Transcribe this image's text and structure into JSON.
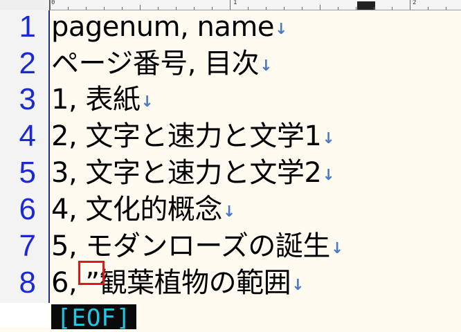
{
  "ruler": {
    "labels": [
      "0",
      "1",
      "2"
    ]
  },
  "lines": [
    {
      "number": "1",
      "text": "pagenum, name"
    },
    {
      "number": "2",
      "text": "ページ番号, 目次"
    },
    {
      "number": "3",
      "text": "1, 表紙"
    },
    {
      "number": "4",
      "text": "2, 文字と速力と文学1"
    },
    {
      "number": "5",
      "text": "3, 文字と速力と文学2"
    },
    {
      "number": "6",
      "text": "4, 文化的概念"
    },
    {
      "number": "7",
      "text": "5, モダンローズの誕生"
    },
    {
      "number": "8",
      "text": "6, ”観葉植物の範囲"
    }
  ],
  "newline_mark": "↓",
  "eof_label": "[EOF]",
  "colors": {
    "line_number": "#1a28d6",
    "newline_mark": "#4b79c9",
    "highlight_box": "#e31717",
    "eof_text": "#1ec8e6",
    "eof_background": "#0a0a0a",
    "background": "#fffbf0"
  }
}
